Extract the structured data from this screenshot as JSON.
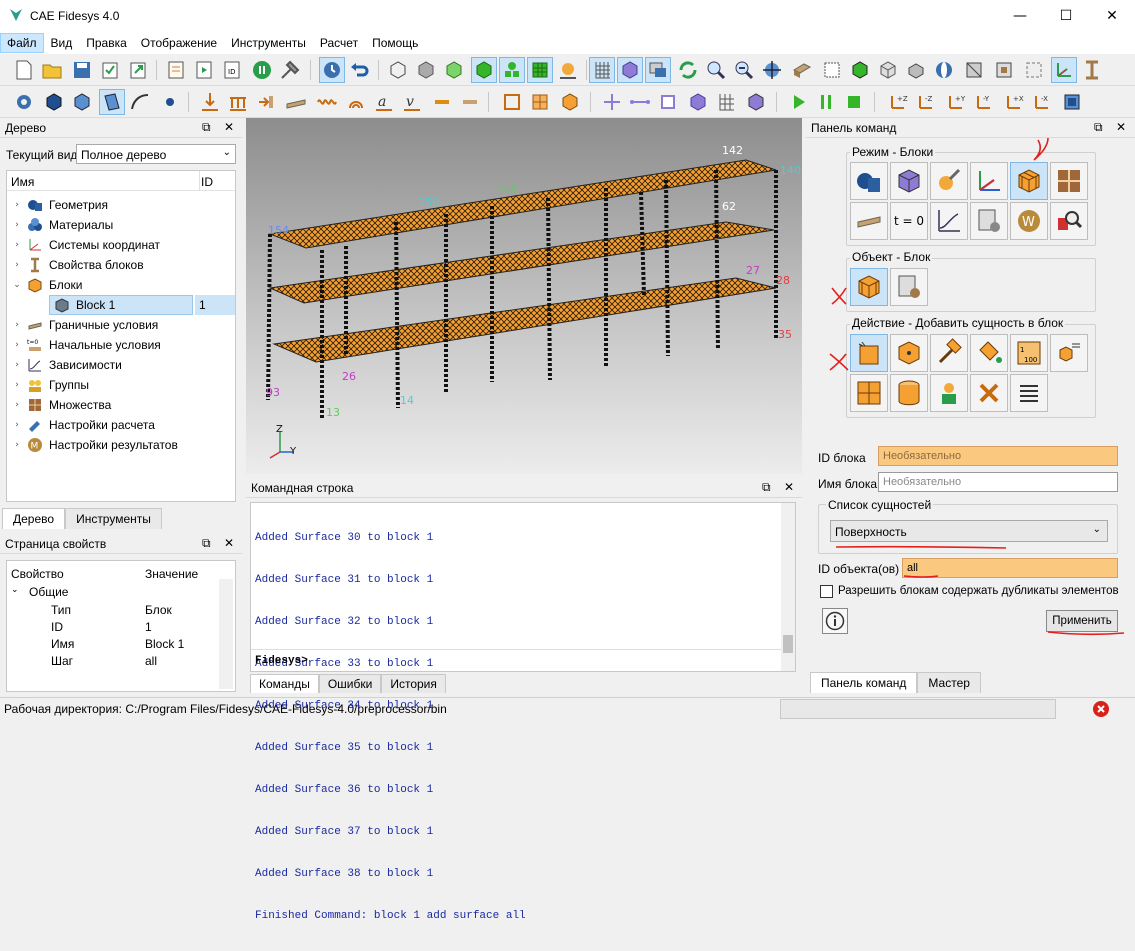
{
  "window": {
    "title": "CAE Fidesys 4.0",
    "minimize": "—",
    "maximize": "☐",
    "close": "✕"
  },
  "menu": [
    "Файл",
    "Вид",
    "Правка",
    "Отображение",
    "Инструменты",
    "Расчет",
    "Помощь"
  ],
  "tree_panel": {
    "title": "Дерево",
    "view_label": "Текущий вид",
    "view_value": "Полное дерево",
    "col_name": "Имя",
    "col_id": "ID",
    "items": [
      {
        "label": "Геометрия",
        "icon": "geometry-icon"
      },
      {
        "label": "Материалы",
        "icon": "materials-icon"
      },
      {
        "label": "Системы координат",
        "icon": "coordinate-systems-icon"
      },
      {
        "label": "Свойства блоков",
        "icon": "block-properties-icon"
      },
      {
        "label": "Блоки",
        "icon": "blocks-icon"
      },
      {
        "label": "Block 1",
        "id": "1",
        "icon": "block-icon"
      },
      {
        "label": "Граничные условия",
        "icon": "boundary-conditions-icon"
      },
      {
        "label": "Начальные условия",
        "icon": "initial-conditions-icon"
      },
      {
        "label": "Зависимости",
        "icon": "dependencies-icon"
      },
      {
        "label": "Группы",
        "icon": "groups-icon"
      },
      {
        "label": "Множества",
        "icon": "sets-icon"
      },
      {
        "label": "Настройки расчета",
        "icon": "analysis-settings-icon"
      },
      {
        "label": "Настройки результатов",
        "icon": "results-settings-icon"
      }
    ],
    "tabs": [
      "Дерево",
      "Инструменты"
    ]
  },
  "props_panel": {
    "title": "Страница свойств",
    "col_prop": "Свойство",
    "col_value": "Значение",
    "group": "Общие",
    "rows": [
      {
        "name": "Тип",
        "value": "Блок"
      },
      {
        "name": "ID",
        "value": "1"
      },
      {
        "name": "Имя",
        "value": "Block 1"
      },
      {
        "name": "Шаг",
        "value": "all"
      }
    ]
  },
  "viewport": {
    "axis_z": "Z",
    "axis_y": "Y",
    "labels": [
      "142",
      "140",
      "148",
      "150",
      "154",
      "62",
      "27",
      "28",
      "35",
      "93",
      "14",
      "13",
      "26"
    ]
  },
  "command_panel": {
    "title": "Командная строка",
    "lines": [
      "Added Surface 30 to block 1",
      "Added Surface 31 to block 1",
      "Added Surface 32 to block 1",
      "Added Surface 33 to block 1",
      "Added Surface 34 to block 1",
      "Added Surface 35 to block 1",
      "Added Surface 36 to block 1",
      "Added Surface 37 to block 1",
      "Added Surface 38 to block 1",
      "Finished Command: block 1 add surface all"
    ],
    "prompt": "Fidesys>",
    "tabs": [
      "Команды",
      "Ошибки",
      "История"
    ]
  },
  "command_bar": {
    "title": "Панель команд",
    "mode_label": "Режим - Блоки",
    "object_label": "Объект - Блок",
    "action_label": "Действие - Добавить сущность в блок",
    "mode_row1_t0": "t = 0",
    "block_id_label": "ID блока",
    "block_id_placeholder": "Необязательно",
    "block_name_label": "Имя блока",
    "block_name_placeholder": "Необязательно",
    "entity_list_label": "Список сущностей",
    "entity_value": "Поверхность",
    "object_ids_label": "ID объекта(ов)",
    "object_ids_value": "all",
    "allow_duplicates": "Разрешить блокам содержать дубликаты элементов",
    "apply": "Применить",
    "tabs": [
      "Панель команд",
      "Мастер"
    ]
  },
  "status": {
    "workdir": "Рабочая директория: C:/Program Files/Fidesys/CAE-Fidesys-4.0/preprocessor/bin"
  },
  "colors": {
    "accent": "#cce4f7",
    "surface": "#f5a033",
    "mark": "#e3201b"
  }
}
